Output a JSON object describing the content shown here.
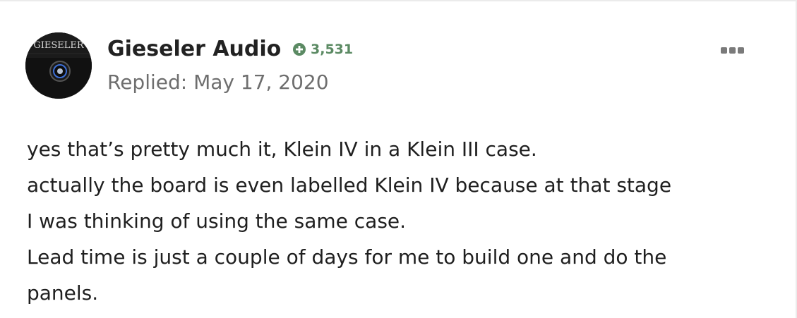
{
  "post": {
    "author": {
      "name": "Gieseler Audio",
      "avatar_text": "GIESELER",
      "reputation_icon": "plus-circle-icon",
      "reputation": "3,531"
    },
    "replied": "Replied: May 17, 2020",
    "menu_icon": "more-options-icon",
    "body": [
      "yes that’s pretty much it, Klein IV in a Klein III case.",
      "actually the board is even labelled Klein IV because at that stage",
      "I was thinking of using the same case.",
      "Lead time is just a couple of days for me to build one and do the",
      "panels."
    ]
  },
  "colors": {
    "reputation": "#5b8a63",
    "name": "#222222",
    "meta": "#6e6e6e",
    "body": "#1f1f1f"
  }
}
